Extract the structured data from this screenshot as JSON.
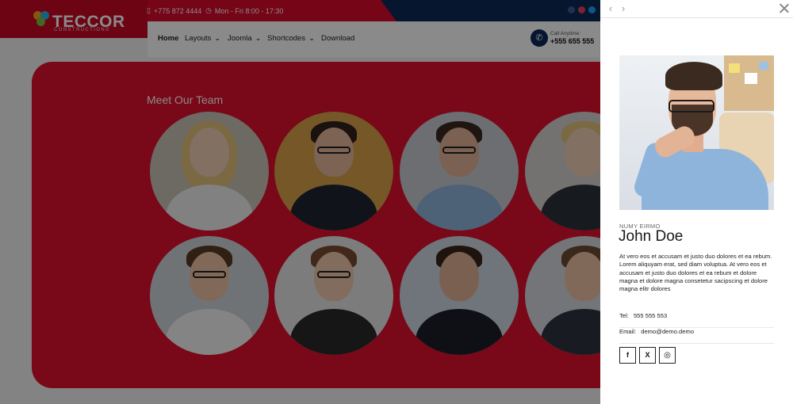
{
  "site": {
    "logo_text": "TECCOR",
    "logo_tagline": "CONSTRUCTIONS",
    "topbar": {
      "phone": "+775 872 4444",
      "hours": "Mon - Fri 8:00 - 17:30"
    },
    "nav": [
      {
        "label": "Home"
      },
      {
        "label": "Layouts"
      },
      {
        "label": "Joomla"
      },
      {
        "label": "Shortcodes"
      },
      {
        "label": "Download"
      }
    ],
    "call": {
      "label": "Call Anytime:",
      "number": "+555 655 555"
    },
    "team_title": "Meet Our Team"
  },
  "modal": {
    "prev_icon": "chevron-left-icon",
    "next_icon": "chevron-right-icon",
    "close_icon": "close-icon",
    "role": "NUMY EIRMO",
    "name": "John Doe",
    "bio": "At vero eos et accusam et justo duo dolores et ea rebum. Lorem aliquyam erat, sed diam voluptua. At vero eos et accusam et justo duo dolores et ea rebum et dolore magna et dolore magna consetetur sacipscing et dolore magna elitr dolores",
    "tel_label": "Tel:",
    "tel": "555 555 553",
    "email_label": "Email:",
    "email": "demo@demo.demo",
    "social": [
      {
        "icon": "facebook-icon",
        "glyph": "f"
      },
      {
        "icon": "x-icon",
        "glyph": "X"
      },
      {
        "icon": "instagram-icon",
        "glyph": "◎"
      }
    ]
  },
  "colors": {
    "brand_red": "#e0102e",
    "brand_navy": "#0c2a55"
  }
}
